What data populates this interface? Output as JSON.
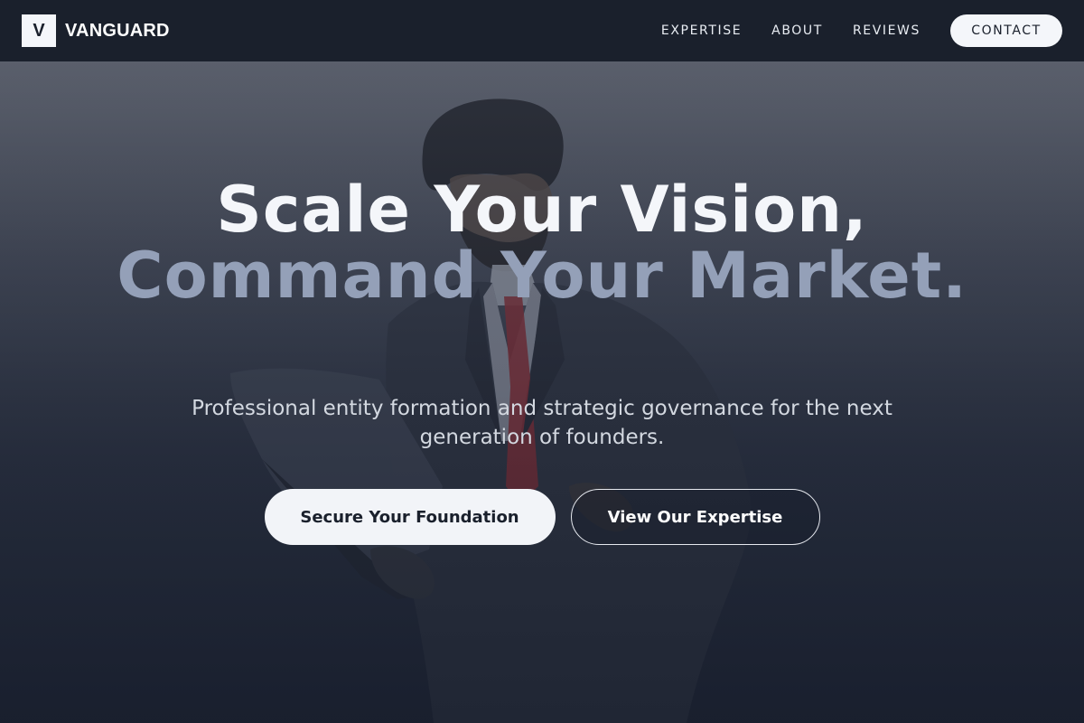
{
  "nav": {
    "logo_letter": "V",
    "brand": "VANGUARD",
    "links": [
      "EXPERTISE",
      "ABOUT",
      "REVIEWS"
    ],
    "contact_label": "CONTACT"
  },
  "hero": {
    "headline_line1": "Scale Your Vision,",
    "headline_line2": "Command Your Market.",
    "subtitle": "Professional entity formation and strategic governance for the next generation of founders.",
    "primary_cta": "Secure Your Foundation",
    "secondary_cta": "View Our Expertise",
    "background_image": "businessman-holding-laptop-photo"
  },
  "colors": {
    "nav_bg": "#1a202c",
    "accent_muted": "#94a0b8",
    "button_light": "#f2f4f8"
  }
}
